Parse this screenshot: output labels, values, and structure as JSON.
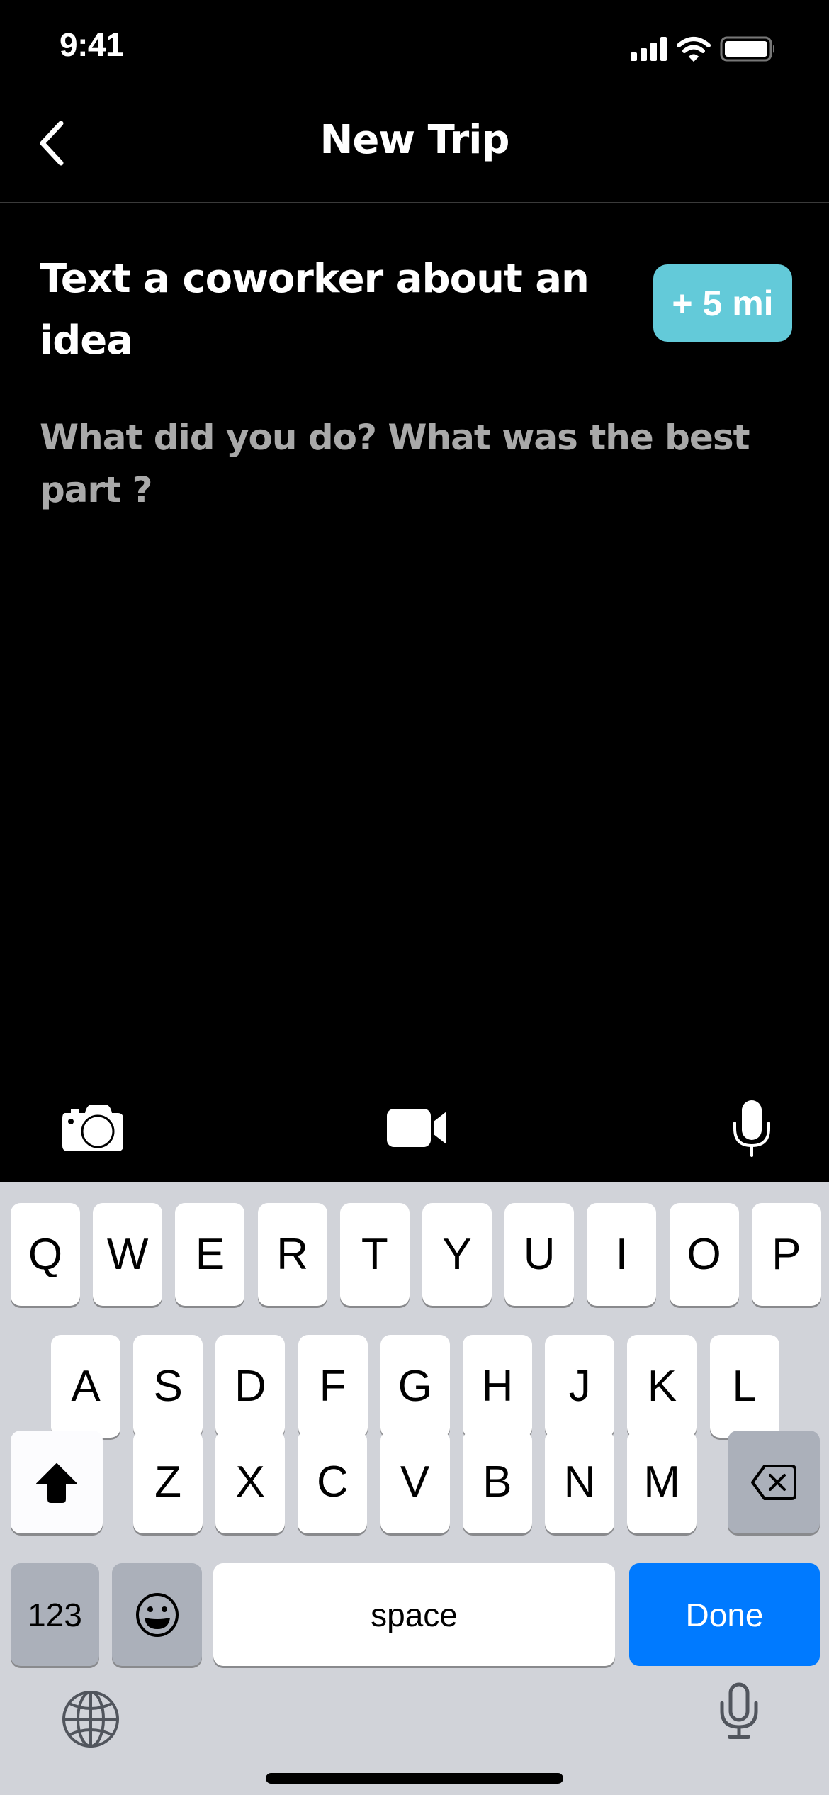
{
  "status_bar": {
    "time": "9:41",
    "battery_level": 1.0
  },
  "nav": {
    "title": "New Trip",
    "back_icon": "chevron-left-icon"
  },
  "task": {
    "title": "Text a coworker about an idea",
    "badge": "+ 5 mi",
    "badge_color": "#63CAD9"
  },
  "note": {
    "value": "",
    "placeholder": "What did you do? What was the best part ?"
  },
  "toolbar": {
    "items": [
      "camera-icon",
      "video-icon",
      "microphone-icon"
    ]
  },
  "keyboard": {
    "row1": [
      "Q",
      "W",
      "E",
      "R",
      "T",
      "Y",
      "U",
      "I",
      "O",
      "P"
    ],
    "row2": [
      "A",
      "S",
      "D",
      "F",
      "G",
      "H",
      "J",
      "K",
      "L"
    ],
    "row3": [
      "Z",
      "X",
      "C",
      "V",
      "B",
      "N",
      "M"
    ],
    "numbers_label": "123",
    "space_label": "space",
    "done_label": "Done",
    "done_color": "#007AFF"
  }
}
